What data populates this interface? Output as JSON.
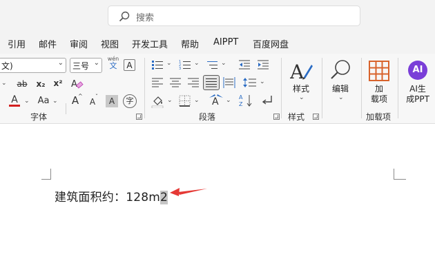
{
  "search": {
    "placeholder": "搜索"
  },
  "menu": [
    "引用",
    "邮件",
    "审阅",
    "视图",
    "开发工具",
    "帮助",
    "AIPPT",
    "百度网盘"
  ],
  "font": {
    "name_value": "文)",
    "size_value": "三号",
    "phonetic_top": "wén",
    "phonetic_bottom": "文",
    "char_box": "A",
    "strike": "ab",
    "subscript": "x₂",
    "superscript": "x²",
    "font_color": "A",
    "change_case": "Aa",
    "grow": "A",
    "shrink": "A",
    "shading": "A",
    "enclose": "字",
    "group_label": "字体"
  },
  "paragraph": {
    "group_label": "段落"
  },
  "styles": {
    "button_label": "样式",
    "group_label": "样式"
  },
  "editing": {
    "button_label": "编辑"
  },
  "addins": {
    "button_line1": "加",
    "button_line2": "载项",
    "group_label": "加载项"
  },
  "ai": {
    "logo": "AI",
    "button_line1": "AI生",
    "button_line2": "成PPT"
  },
  "document": {
    "text_main": "建筑面积约：128m",
    "text_selected": "2"
  },
  "colors": {
    "accent_red": "#e03030",
    "font_color_bar": "#d32020",
    "arrow": "#e53935",
    "addins_orange": "#d8632c",
    "ai_purple": "#7a3ed8"
  }
}
